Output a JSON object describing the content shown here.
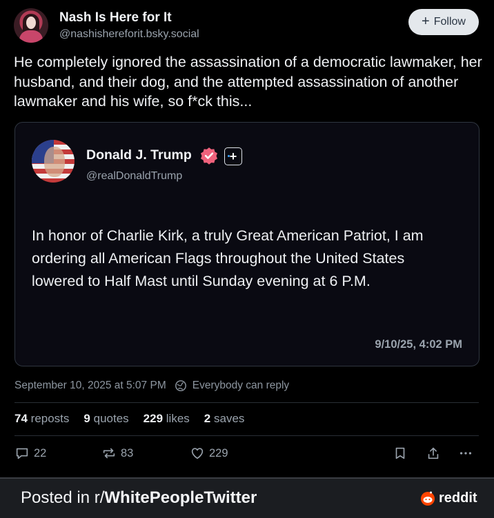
{
  "author": {
    "display_name": "Nash Is Here for It",
    "handle": "@nashishereforit.bsky.social"
  },
  "follow_button": {
    "label": "Follow",
    "icon": "plus-icon"
  },
  "post": {
    "text": "He completely ignored the assassination of a democratic lawmaker, her husband, and their dog, and the attempted assassination of another lawmaker and his wife, so f*ck this..."
  },
  "quoted": {
    "display_name": "Donald J. Trump",
    "handle": "@realDonaldTrump",
    "text": "In honor of Charlie Kirk, a truly Great American Patriot, I am ordering all American Flags throughout the United States lowered to Half Mast until Sunday evening at 6 P.M.",
    "timestamp": "9/10/25, 4:02 PM"
  },
  "meta": {
    "date": "September 10, 2025 at 5:07 PM",
    "reply_setting": "Everybody can reply"
  },
  "stats": [
    {
      "count": "74",
      "label": "reposts"
    },
    {
      "count": "9",
      "label": "quotes"
    },
    {
      "count": "229",
      "label": "likes"
    },
    {
      "count": "2",
      "label": "saves"
    }
  ],
  "actions": {
    "replies": "22",
    "reposts": "83",
    "likes": "229"
  },
  "footer": {
    "prefix": "Posted in r/",
    "subreddit": "WhitePeopleTwitter",
    "brand": "reddit"
  },
  "colors": {
    "background": "#000000",
    "verified_badge": "#f0627c",
    "footer_bg": "#1b1d21",
    "reddit_orange": "#ff4500"
  }
}
